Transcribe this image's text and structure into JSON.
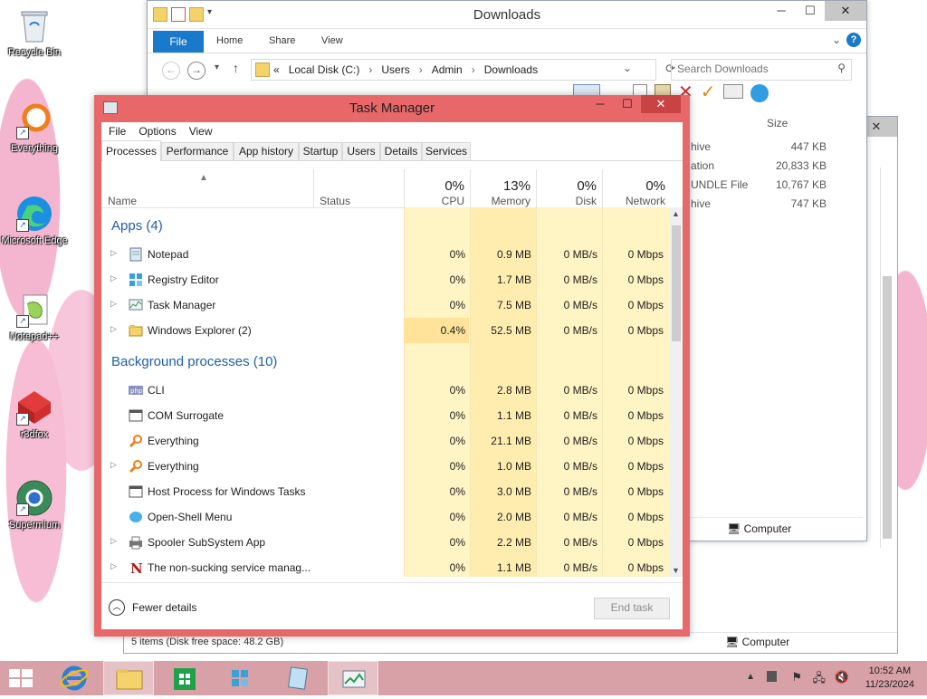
{
  "desktop": {
    "icons": [
      {
        "label": "Recycle Bin"
      },
      {
        "label": "Everything"
      },
      {
        "label": "Microsoft Edge"
      },
      {
        "label": "Notepad++"
      },
      {
        "label": "r3dfox"
      },
      {
        "label": "Supermium"
      }
    ]
  },
  "explorer": {
    "title": "Downloads",
    "ribbon": {
      "file": "File",
      "tabs": [
        "Home",
        "Share",
        "View"
      ],
      "help": "?"
    },
    "address": {
      "prefix": "«",
      "crumbs": [
        "Local Disk (C:)",
        "Users",
        "Admin",
        "Downloads"
      ]
    },
    "search": {
      "placeholder": "Search Downloads"
    },
    "size_header": "Size",
    "rows": [
      {
        "type": "hive",
        "size": "447 KB"
      },
      {
        "type": "ation",
        "size": "20,833 KB"
      },
      {
        "type": "UNDLE File",
        "size": "10,767 KB"
      },
      {
        "type": "hive",
        "size": "747 KB"
      }
    ],
    "status_computer": "Computer"
  },
  "explorer2": {
    "status_free": "5 items (Disk free space: 48.2 GB)",
    "status_computer": "Computer"
  },
  "taskmanager": {
    "title": "Task Manager",
    "menu": [
      "File",
      "Options",
      "View"
    ],
    "tabs": [
      "Processes",
      "Performance",
      "App history",
      "Startup",
      "Users",
      "Details",
      "Services"
    ],
    "columns": {
      "name": "Name",
      "status": "Status",
      "cpu": {
        "pct": "0%",
        "label": "CPU"
      },
      "memory": {
        "pct": "13%",
        "label": "Memory"
      },
      "disk": {
        "pct": "0%",
        "label": "Disk"
      },
      "network": {
        "pct": "0%",
        "label": "Network"
      }
    },
    "groups": {
      "apps": "Apps (4)",
      "background": "Background processes (10)"
    },
    "apps": [
      {
        "name": "Notepad",
        "cpu": "0%",
        "mem": "0.9 MB",
        "disk": "0 MB/s",
        "net": "0 Mbps",
        "expandable": true,
        "icon": "notepad-icon"
      },
      {
        "name": "Registry Editor",
        "cpu": "0%",
        "mem": "1.7 MB",
        "disk": "0 MB/s",
        "net": "0 Mbps",
        "expandable": true,
        "icon": "registry-icon"
      },
      {
        "name": "Task Manager",
        "cpu": "0%",
        "mem": "7.5 MB",
        "disk": "0 MB/s",
        "net": "0 Mbps",
        "expandable": true,
        "icon": "taskmanager-icon"
      },
      {
        "name": "Windows Explorer (2)",
        "cpu": "0.4%",
        "mem": "52.5 MB",
        "disk": "0 MB/s",
        "net": "0 Mbps",
        "expandable": true,
        "icon": "folder-icon"
      }
    ],
    "background": [
      {
        "name": "CLI",
        "cpu": "0%",
        "mem": "2.8 MB",
        "disk": "0 MB/s",
        "net": "0 Mbps",
        "expandable": false,
        "icon": "php-icon"
      },
      {
        "name": "COM Surrogate",
        "cpu": "0%",
        "mem": "1.1 MB",
        "disk": "0 MB/s",
        "net": "0 Mbps",
        "expandable": false,
        "icon": "window-icon"
      },
      {
        "name": "Everything",
        "cpu": "0%",
        "mem": "21.1 MB",
        "disk": "0 MB/s",
        "net": "0 Mbps",
        "expandable": false,
        "icon": "magnifier-icon"
      },
      {
        "name": "Everything",
        "cpu": "0%",
        "mem": "1.0 MB",
        "disk": "0 MB/s",
        "net": "0 Mbps",
        "expandable": true,
        "icon": "magnifier-icon"
      },
      {
        "name": "Host Process for Windows Tasks",
        "cpu": "0%",
        "mem": "3.0 MB",
        "disk": "0 MB/s",
        "net": "0 Mbps",
        "expandable": false,
        "icon": "window-icon"
      },
      {
        "name": "Open-Shell Menu",
        "cpu": "0%",
        "mem": "2.0 MB",
        "disk": "0 MB/s",
        "net": "0 Mbps",
        "expandable": false,
        "icon": "shell-icon"
      },
      {
        "name": "Spooler SubSystem App",
        "cpu": "0%",
        "mem": "2.2 MB",
        "disk": "0 MB/s",
        "net": "0 Mbps",
        "expandable": true,
        "icon": "printer-icon"
      },
      {
        "name": "The non-sucking service manag...",
        "cpu": "0%",
        "mem": "1.1 MB",
        "disk": "0 MB/s",
        "net": "0 Mbps",
        "expandable": true,
        "icon": "nssm-icon"
      }
    ],
    "footer": {
      "fewer_details": "Fewer details",
      "end_task": "End task"
    }
  },
  "taskbar": {
    "clock_time": "10:52 AM",
    "clock_date": "11/23/2024"
  },
  "colors": {
    "tm_frame": "#e8686a",
    "heat_light": "#fff4c4",
    "heat_mem": "#ffedb0",
    "group_text": "#1f5fa6",
    "taskbar": "#d8a1a7"
  }
}
